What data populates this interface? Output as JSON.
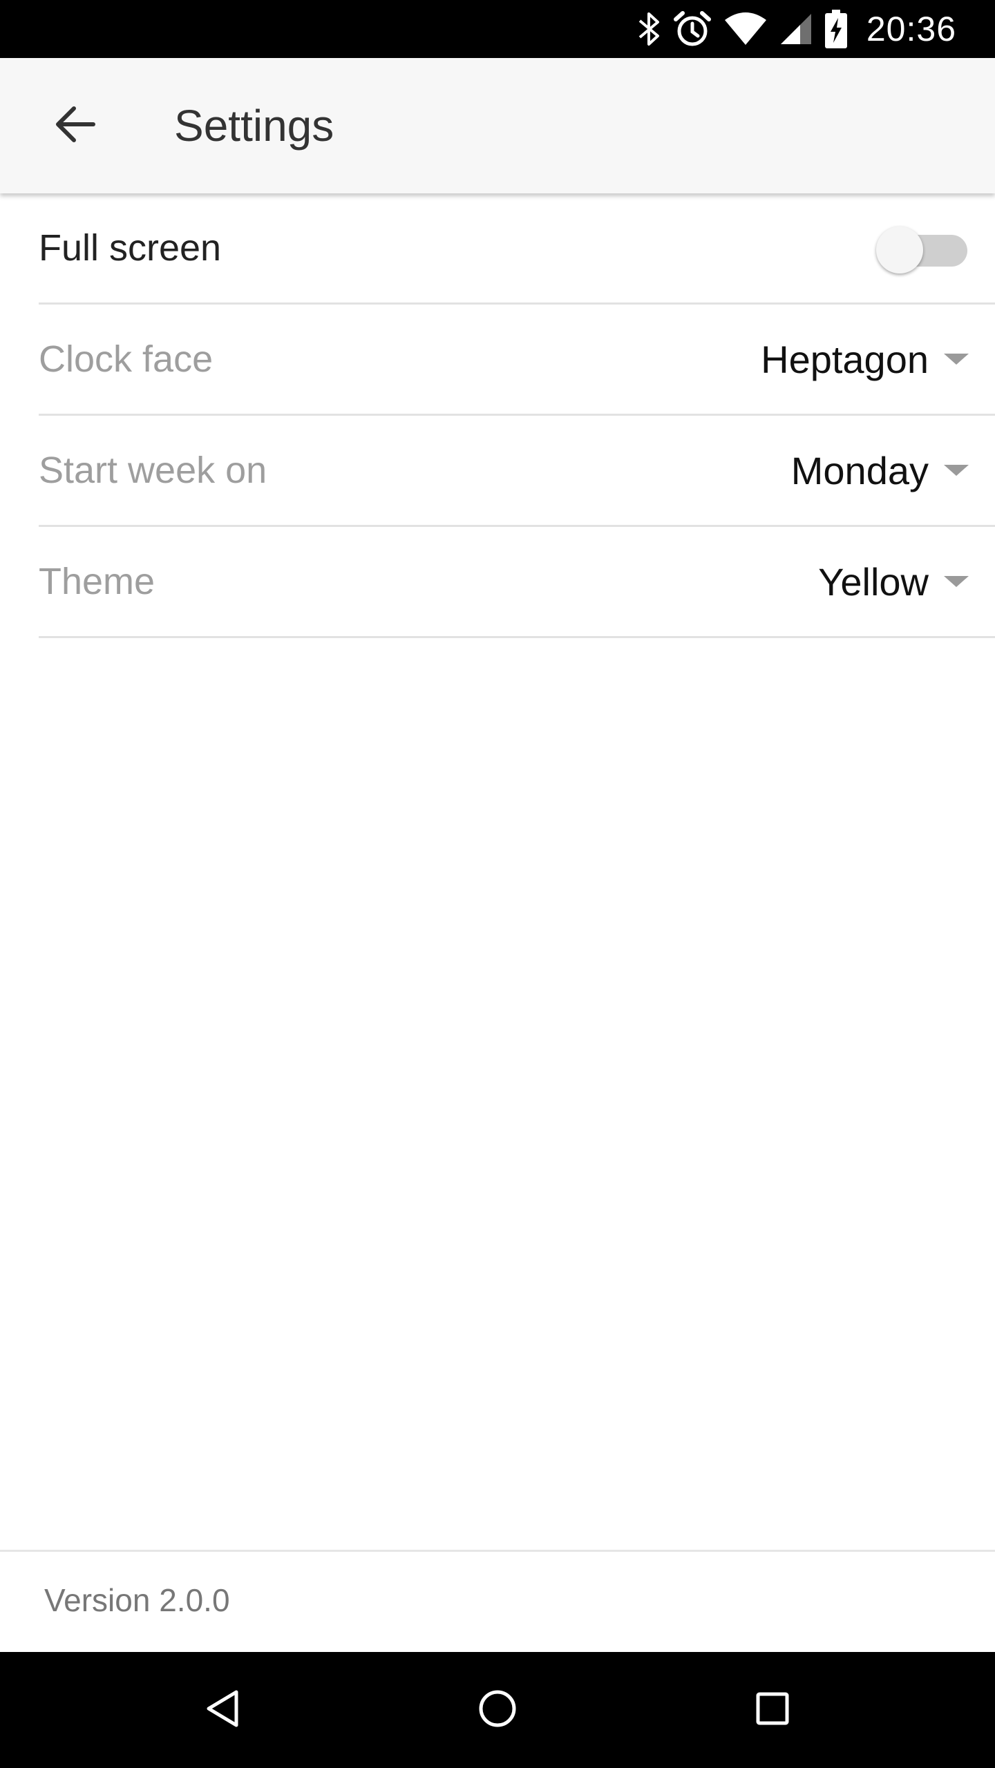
{
  "status_bar": {
    "time": "20:36",
    "icons": [
      "bluetooth-icon",
      "alarm-icon",
      "wifi-icon",
      "cell-signal-icon",
      "battery-charging-icon"
    ]
  },
  "app_bar": {
    "title": "Settings",
    "back_icon": "arrow-back-icon"
  },
  "settings": {
    "full_screen": {
      "label": "Full screen",
      "enabled": false
    },
    "clock_face": {
      "label": "Clock face",
      "value": "Heptagon"
    },
    "start_week_on": {
      "label": "Start week on",
      "value": "Monday"
    },
    "theme": {
      "label": "Theme",
      "value": "Yellow"
    }
  },
  "footer": {
    "version": "Version 2.0.0"
  },
  "nav_bar": {
    "icons": [
      "nav-back-icon",
      "nav-home-icon",
      "nav-recents-icon"
    ]
  },
  "colors": {
    "toggle_track_off": "#cfcfcf",
    "toggle_thumb_off": "#f5f5f5",
    "app_bar_bg": "#f7f7f7",
    "divider": "#e2e2e2"
  }
}
